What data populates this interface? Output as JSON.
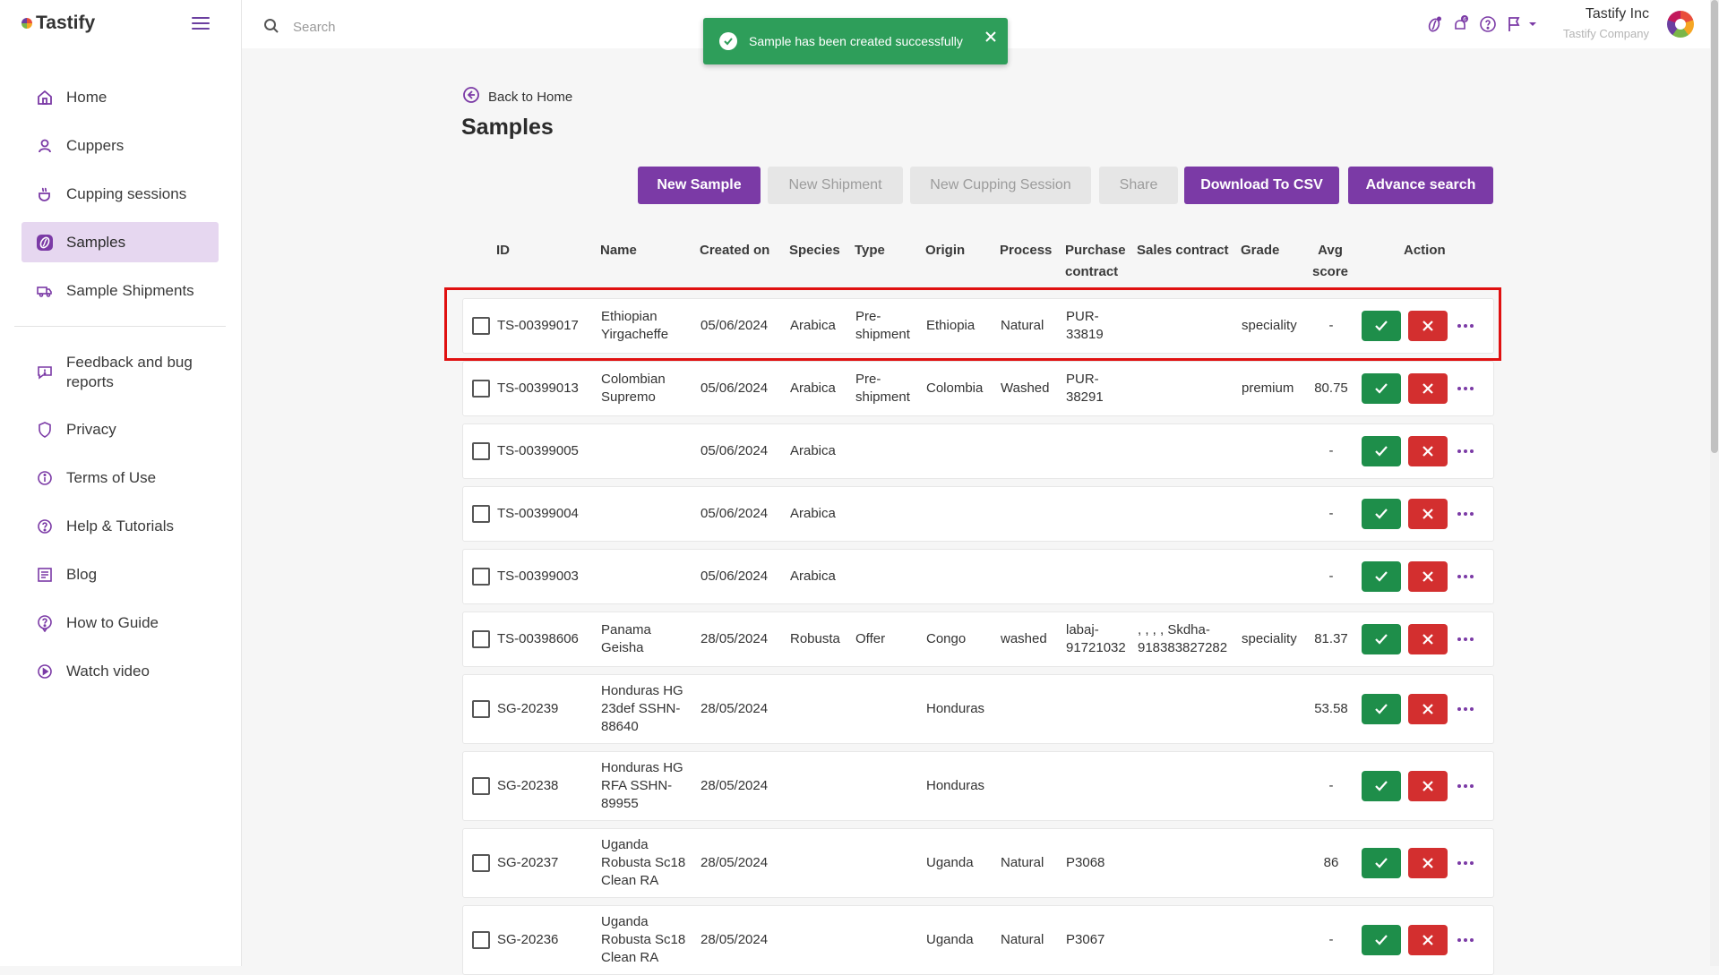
{
  "app": {
    "logo_text": "Tastify"
  },
  "sidebar": {
    "items": [
      {
        "label": "Home",
        "icon": "home-icon"
      },
      {
        "label": "Cuppers",
        "icon": "user-icon"
      },
      {
        "label": "Cupping sessions",
        "icon": "cup-icon"
      },
      {
        "label": "Samples",
        "icon": "coffee-bean-icon",
        "active": true
      },
      {
        "label": "Sample Shipments",
        "icon": "truck-icon"
      },
      {
        "label": "Feedback and bug reports",
        "icon": "feedback-icon"
      },
      {
        "label": "Privacy",
        "icon": "shield-icon"
      },
      {
        "label": "Terms of Use",
        "icon": "info-icon"
      },
      {
        "label": "Help & Tutorials",
        "icon": "help-icon"
      },
      {
        "label": "Blog",
        "icon": "blog-icon"
      },
      {
        "label": "How to Guide",
        "icon": "guide-icon"
      },
      {
        "label": "Watch video",
        "icon": "play-icon"
      }
    ]
  },
  "header": {
    "search_placeholder": "Search",
    "user_name": "Tastify Inc",
    "user_company": "Tastify Company"
  },
  "toast": {
    "message": "Sample has been created successfully"
  },
  "page": {
    "back_label": "Back to Home",
    "title": "Samples"
  },
  "toolbar": {
    "new_sample": "New Sample",
    "new_shipment": "New Shipment",
    "new_cupping_session": "New Cupping Session",
    "share": "Share",
    "download_csv": "Download To CSV",
    "advance_search": "Advance search"
  },
  "table": {
    "headers": {
      "id": "ID",
      "name": "Name",
      "created_on": "Created on",
      "species": "Species",
      "type": "Type",
      "origin": "Origin",
      "process": "Process",
      "purchase_contract": "Purchase contract",
      "sales_contract": "Sales contract",
      "grade": "Grade",
      "avg_score": "Avg score",
      "action": "Action"
    },
    "rows": [
      {
        "id": "TS-00399017",
        "name": "Ethiopian Yirgacheffe",
        "created": "05/06/2024",
        "species": "Arabica",
        "type": "Pre-shipment",
        "origin": "Ethiopia",
        "process": "Natural",
        "purchase": "PUR-33819",
        "sales": "",
        "grade": "speciality",
        "score": "-"
      },
      {
        "id": "TS-00399013",
        "name": "Colombian Supremo",
        "created": "05/06/2024",
        "species": "Arabica",
        "type": "Pre-shipment",
        "origin": "Colombia",
        "process": "Washed",
        "purchase": "PUR-38291",
        "sales": "",
        "grade": "premium",
        "score": "80.75"
      },
      {
        "id": "TS-00399005",
        "name": "",
        "created": "05/06/2024",
        "species": "Arabica",
        "type": "",
        "origin": "",
        "process": "",
        "purchase": "",
        "sales": "",
        "grade": "",
        "score": "-"
      },
      {
        "id": "TS-00399004",
        "name": "",
        "created": "05/06/2024",
        "species": "Arabica",
        "type": "",
        "origin": "",
        "process": "",
        "purchase": "",
        "sales": "",
        "grade": "",
        "score": "-"
      },
      {
        "id": "TS-00399003",
        "name": "",
        "created": "05/06/2024",
        "species": "Arabica",
        "type": "",
        "origin": "",
        "process": "",
        "purchase": "",
        "sales": "",
        "grade": "",
        "score": "-"
      },
      {
        "id": "TS-00398606",
        "name": "Panama Geisha",
        "created": "28/05/2024",
        "species": "Robusta",
        "type": "Offer",
        "origin": "Congo",
        "process": "washed",
        "purchase": "labaj-91721032",
        "sales": ", , , , Skdha-918383827282",
        "grade": "speciality",
        "score": "81.37"
      },
      {
        "id": "SG-20239",
        "name": "Honduras HG 23def SSHN-88640",
        "created": "28/05/2024",
        "species": "",
        "type": "",
        "origin": "Honduras",
        "process": "",
        "purchase": "",
        "sales": "",
        "grade": "",
        "score": "53.58"
      },
      {
        "id": "SG-20238",
        "name": "Honduras HG RFA SSHN-89955",
        "created": "28/05/2024",
        "species": "",
        "type": "",
        "origin": "Honduras",
        "process": "",
        "purchase": "",
        "sales": "",
        "grade": "",
        "score": "-"
      },
      {
        "id": "SG-20237",
        "name": "Uganda Robusta Sc18 Clean RA",
        "created": "28/05/2024",
        "species": "",
        "type": "",
        "origin": "Uganda",
        "process": "Natural",
        "purchase": "P3068",
        "sales": "",
        "grade": "",
        "score": "86"
      },
      {
        "id": "SG-20236",
        "name": "Uganda Robusta Sc18 Clean RA",
        "created": "28/05/2024",
        "species": "",
        "type": "",
        "origin": "Uganda",
        "process": "Natural",
        "purchase": "P3067",
        "sales": "",
        "grade": "",
        "score": "-"
      }
    ]
  },
  "colors": {
    "primary": "#7b3aa6",
    "success": "#2e9e5a",
    "approve": "#1e8e4a",
    "reject": "#d32f2f",
    "highlight": "#e01010"
  }
}
